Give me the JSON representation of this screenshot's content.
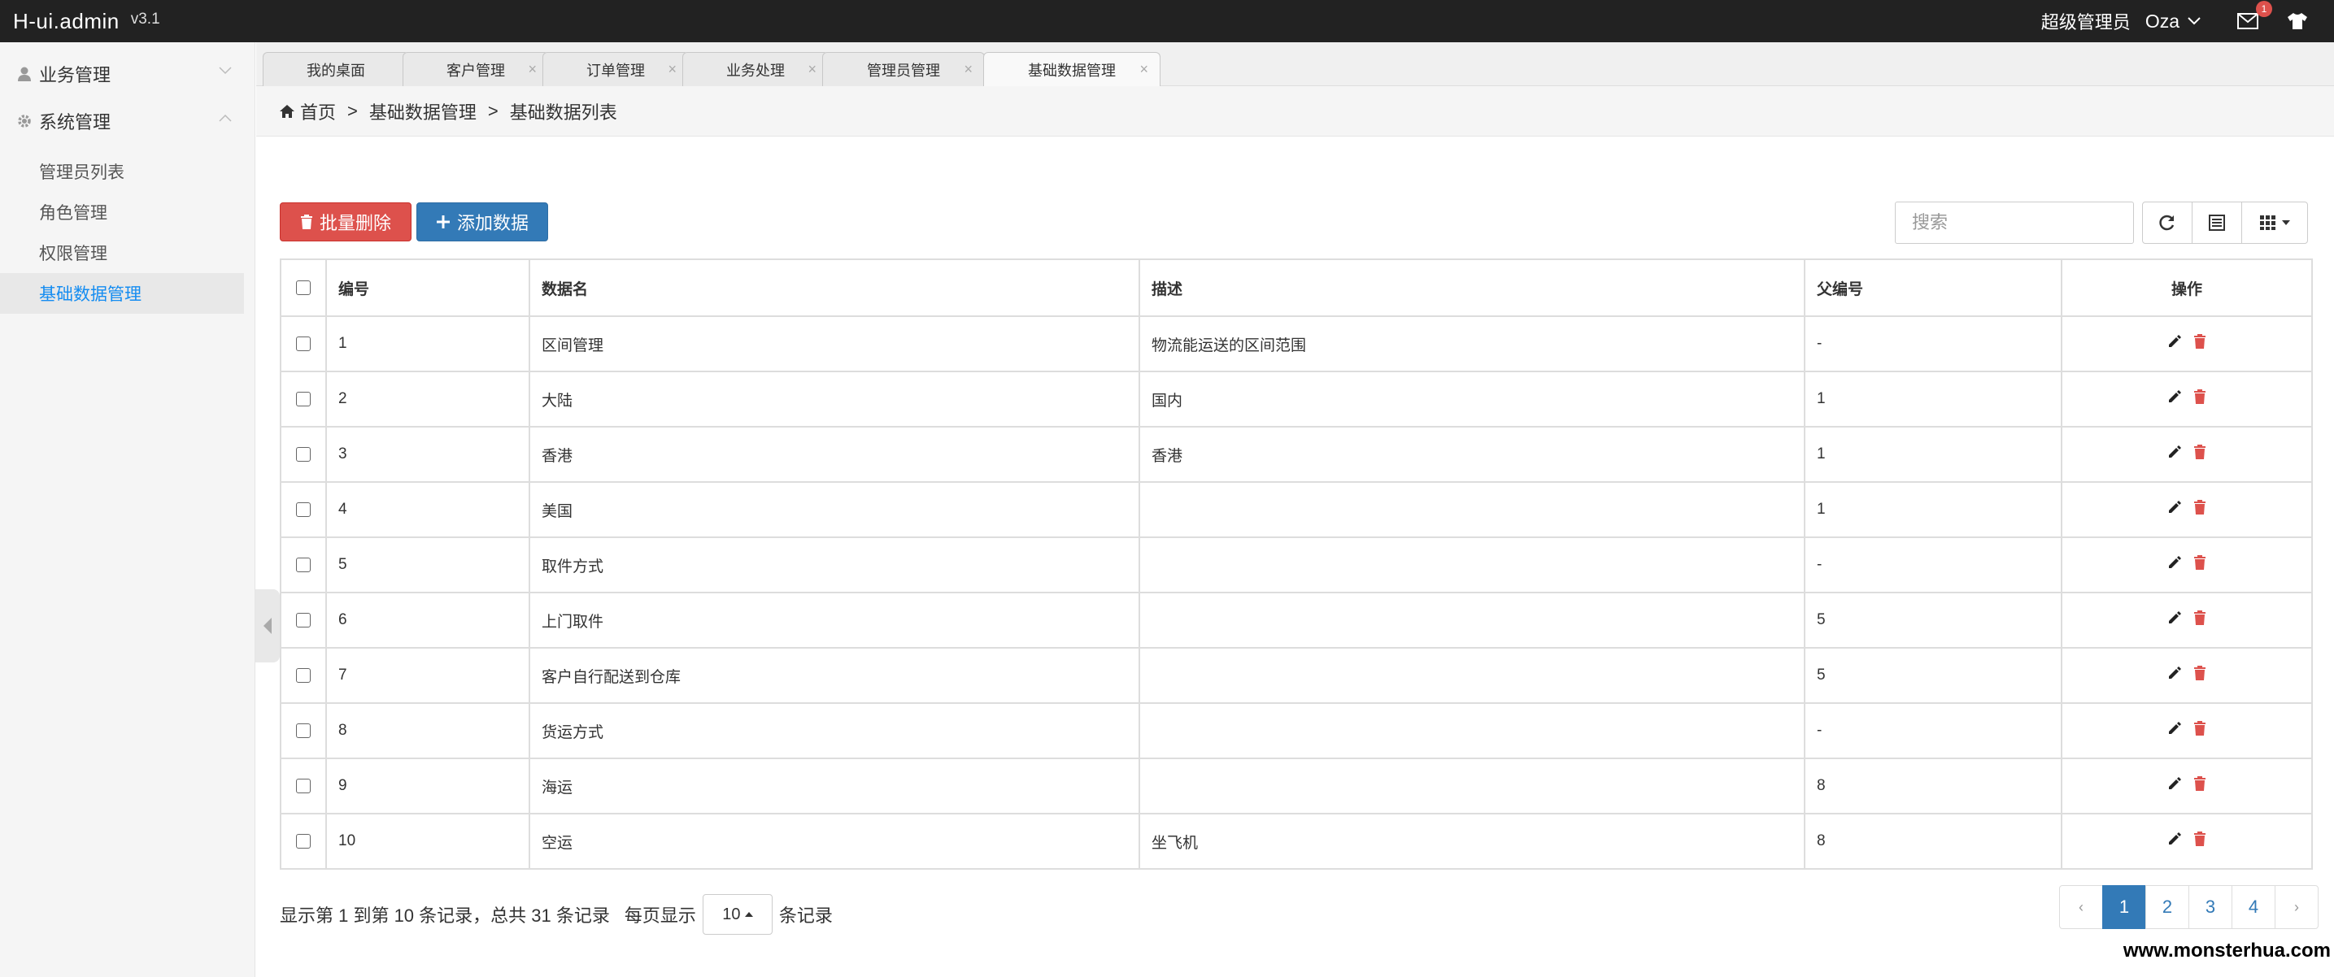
{
  "header": {
    "logo": "H-ui.admin",
    "version": "v3.1",
    "role": "超级管理员",
    "user": "Oza",
    "mail_badge": "1"
  },
  "sidebar": {
    "groups": [
      {
        "label": "业务管理",
        "icon": "user-icon",
        "expanded": false
      },
      {
        "label": "系统管理",
        "icon": "gear-icon",
        "expanded": true
      }
    ],
    "items": [
      {
        "label": "管理员列表"
      },
      {
        "label": "角色管理"
      },
      {
        "label": "权限管理"
      },
      {
        "label": "基础数据管理",
        "active": true
      }
    ]
  },
  "tabs": [
    {
      "label": "我的桌面",
      "closable": false
    },
    {
      "label": "客户管理",
      "closable": true
    },
    {
      "label": "订单管理",
      "closable": true
    },
    {
      "label": "业务处理",
      "closable": true
    },
    {
      "label": "管理员管理",
      "closable": true
    },
    {
      "label": "基础数据管理",
      "closable": true,
      "active": true
    }
  ],
  "breadcrumb": {
    "home": "首页",
    "sep": ">",
    "level1": "基础数据管理",
    "level2": "基础数据列表"
  },
  "toolbar": {
    "batch_delete": "批量删除",
    "add": "添加数据",
    "search_placeholder": "搜索"
  },
  "table": {
    "headers": [
      "编号",
      "数据名",
      "描述",
      "父编号",
      "操作"
    ],
    "rows": [
      [
        "1",
        "区间管理",
        "物流能运送的区间范围",
        "-"
      ],
      [
        "2",
        "大陆",
        "国内",
        "1"
      ],
      [
        "3",
        "香港",
        "香港",
        "1"
      ],
      [
        "4",
        "美国",
        "",
        "1"
      ],
      [
        "5",
        "取件方式",
        "",
        "-"
      ],
      [
        "6",
        "上门取件",
        "",
        "5"
      ],
      [
        "7",
        "客户自行配送到仓库",
        "",
        "5"
      ],
      [
        "8",
        "货运方式",
        "",
        "-"
      ],
      [
        "9",
        "海运",
        "",
        "8"
      ],
      [
        "10",
        "空运",
        "坐飞机",
        "8"
      ]
    ]
  },
  "footer": {
    "info": "显示第 1 到第 10 条记录，总共 31 条记录",
    "per_page_prefix": "每页显示",
    "per_page_value": "10",
    "per_page_suffix": "条记录",
    "pages": [
      "‹",
      "1",
      "2",
      "3",
      "4",
      "›"
    ],
    "active_page": "1"
  },
  "watermark": "www.monsterhua.com",
  "colors": {
    "danger": "#dd514c",
    "primary": "#337ab7",
    "active_link": "#148cf1",
    "topbar": "#222222"
  }
}
